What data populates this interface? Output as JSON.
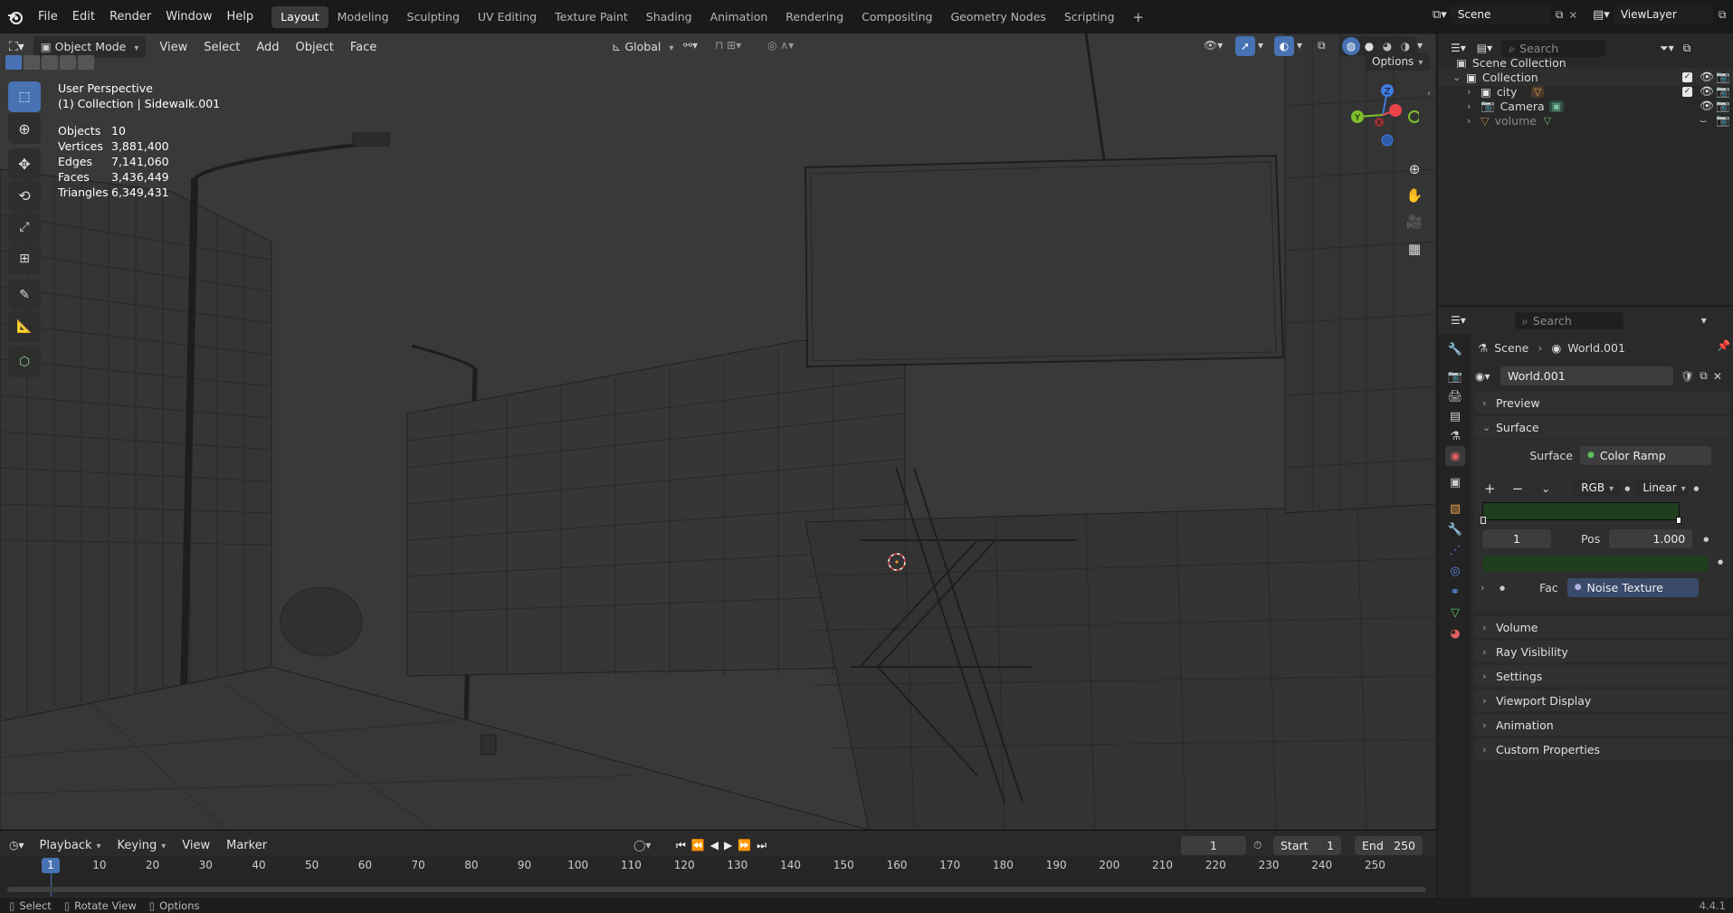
{
  "topbar": {
    "menus": [
      "File",
      "Edit",
      "Render",
      "Window",
      "Help"
    ],
    "workspaces": [
      "Layout",
      "Modeling",
      "Sculpting",
      "UV Editing",
      "Texture Paint",
      "Shading",
      "Animation",
      "Rendering",
      "Compositing",
      "Geometry Nodes",
      "Scripting"
    ],
    "active_workspace": "Layout",
    "add_tab": "+",
    "scene": "Scene",
    "view_layer": "ViewLayer"
  },
  "viewport_header": {
    "mode": "Object Mode",
    "menus": [
      "View",
      "Select",
      "Add",
      "Object",
      "Face"
    ],
    "orientation": "Global",
    "options": "Options"
  },
  "overlay": {
    "perspective": "User Perspective",
    "context": "(1) Collection | Sidewalk.001",
    "stats": [
      {
        "label": "Objects",
        "value": "10"
      },
      {
        "label": "Vertices",
        "value": "3,881,400"
      },
      {
        "label": "Edges",
        "value": "7,141,060"
      },
      {
        "label": "Faces",
        "value": "3,436,449"
      },
      {
        "label": "Triangles",
        "value": "6,349,431"
      }
    ]
  },
  "gizmo": {
    "z": "Z",
    "y": "Y",
    "x": "X"
  },
  "timeline": {
    "menus": [
      "Playback",
      "Keying",
      "View",
      "Marker"
    ],
    "current_frame": "1",
    "start_label": "Start",
    "start": "1",
    "end_label": "End",
    "end": "250",
    "ruler": [
      "1",
      "10",
      "20",
      "30",
      "40",
      "50",
      "60",
      "70",
      "80",
      "90",
      "100",
      "110",
      "120",
      "130",
      "140",
      "150",
      "160",
      "170",
      "180",
      "190",
      "200",
      "210",
      "220",
      "230",
      "240",
      "250"
    ]
  },
  "statusbar": {
    "select": "Select",
    "rotate": "Rotate View",
    "options": "Options",
    "version": "4.4.1"
  },
  "outliner": {
    "search_placeholder": "Search",
    "root": "Scene Collection",
    "collection": "Collection",
    "items": [
      {
        "name": "city",
        "icon": "mesh-icon"
      },
      {
        "name": "Camera",
        "icon": "camera-icon"
      },
      {
        "name": "volume",
        "icon": "mesh-icon"
      }
    ]
  },
  "properties": {
    "search_placeholder": "Search",
    "breadcrumb_scene": "Scene",
    "breadcrumb_world": "World.001",
    "world_name": "World.001",
    "panels_top": [
      "Preview",
      "Surface"
    ],
    "surface_label": "Surface",
    "surface_value": "Color Ramp",
    "color_mode": "RGB",
    "interpolation": "Linear",
    "stop_index": "1",
    "pos_label": "Pos",
    "pos_value": "1.000",
    "fac_label": "Fac",
    "fac_value": "Noise Texture",
    "panels_bottom": [
      "Volume",
      "Ray Visibility",
      "Settings",
      "Viewport Display",
      "Animation",
      "Custom Properties"
    ],
    "accent": "#4772b3",
    "ramp_color": "#1f3d1f"
  }
}
